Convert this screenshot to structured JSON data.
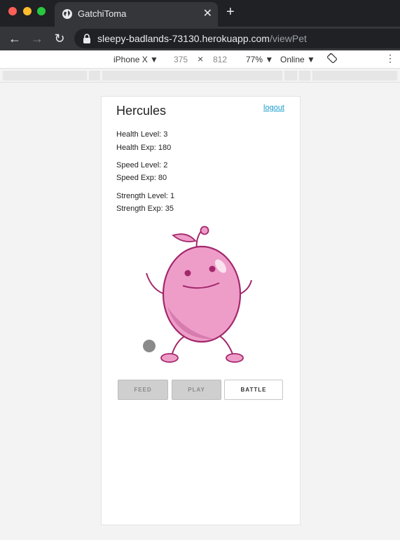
{
  "browser": {
    "tab_title": "GatchiToma",
    "url_host": "sleepy-badlands-73130.herokuapp.com",
    "url_path": "/viewPet",
    "new_tab_glyph": "+",
    "close_glyph": "✕",
    "back_glyph": "←",
    "forward_glyph": "→",
    "reload_glyph": "↻"
  },
  "devtools": {
    "device": "iPhone X ▼",
    "width": "375",
    "times": "×",
    "height": "812",
    "zoom": "77% ▼",
    "network": "Online ▼",
    "more": "⋮"
  },
  "pet": {
    "name": "Hercules",
    "logout_label": "logout",
    "health_level": "Health Level: 3",
    "health_exp": "Health Exp: 180",
    "speed_level": "Speed Level: 2",
    "speed_exp": "Speed Exp: 80",
    "strength_level": "Strength Level: 1",
    "strength_exp": "Strength Exp: 35"
  },
  "actions": {
    "feed_label": "FEED",
    "play_label": "PLAY",
    "battle_label": "BATTLE"
  },
  "colors": {
    "pet_body": "#ee9dc9",
    "pet_outline": "#a3286b",
    "link": "#1a9ccc"
  }
}
